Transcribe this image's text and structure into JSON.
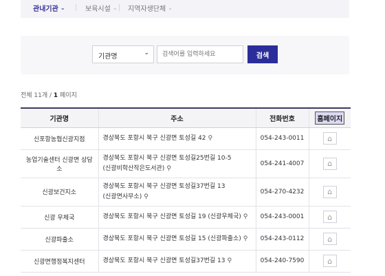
{
  "tabs": [
    {
      "label": "관내기관",
      "active": true
    },
    {
      "label": "보육시설",
      "active": false
    },
    {
      "label": "지역자생단체",
      "active": false
    }
  ],
  "search": {
    "select_value": "기관명",
    "placeholder": "검색어를 입력하세요",
    "button_label": "검색"
  },
  "count": {
    "prefix": "전체 11개 / ",
    "page": "1",
    "suffix": " 페이지"
  },
  "table": {
    "headers": {
      "name": "기관명",
      "address": "주소",
      "phone": "전화번호",
      "homepage": "홈페이지"
    },
    "rows": [
      {
        "name": "신포항농협신광지점",
        "address": "경상북도 포항시 북구 신광면 토성길 42",
        "address2": "",
        "phone": "054-243-0011"
      },
      {
        "name": "농업기술센터 신광면 상담소",
        "address": "경상북도 포항시 북구 신광면 토성길25번길 10-5",
        "address2": "(신광비학산작은도서관)",
        "phone": "054-241-4007"
      },
      {
        "name": "신광보건지소",
        "address": "경상북도 포항시 북구 신광면 토성길37번길 13",
        "address2": "(신광면사무소)",
        "phone": "054-270-4232"
      },
      {
        "name": "신광 우체국",
        "address": "경상북도 포항시 북구 신광면 토성길 19 (신광우체국)",
        "address2": "",
        "phone": "054-243-0001"
      },
      {
        "name": "신광파출소",
        "address": "경상북도 포항시 북구 신광면 토성길 15 (신광파출소)",
        "address2": "",
        "phone": "054-243-0112"
      },
      {
        "name": "신광면행정복지센터",
        "address": "경상북도 포항시 북구 신광면 토성길37번길 13",
        "address2": "",
        "phone": "054-240-7590"
      }
    ]
  },
  "icons": {
    "pin": "map-pin-icon",
    "home": "home-icon",
    "chevron": "chevron-down-icon"
  }
}
